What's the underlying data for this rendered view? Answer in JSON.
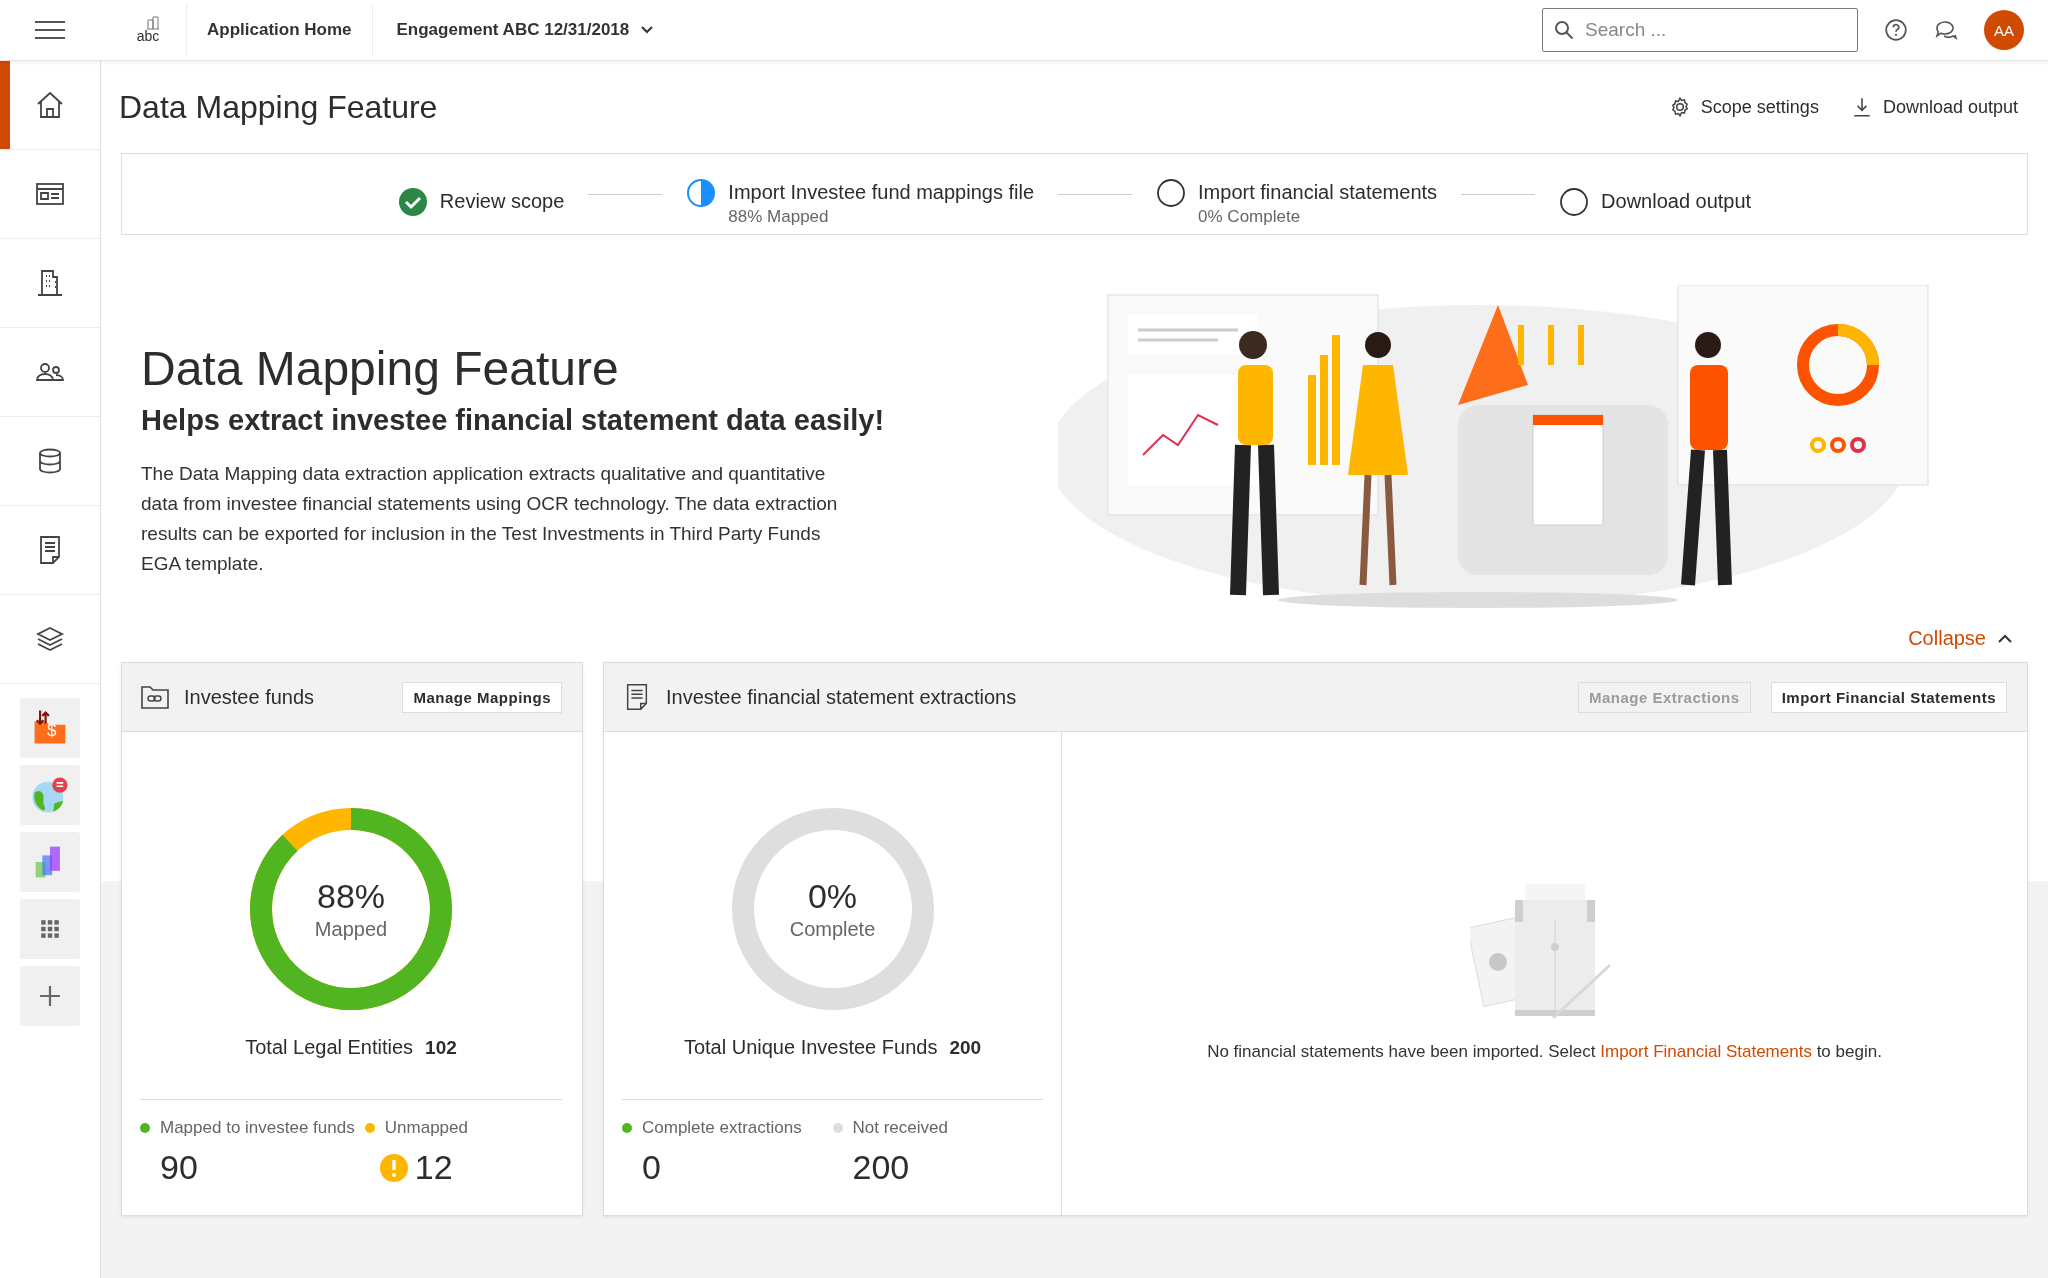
{
  "topbar": {
    "logo": "abc",
    "app_home": "Application Home",
    "engagement": "Engagement ABC 12/31/2018",
    "search": {
      "placeholder": "Search ..."
    },
    "avatar": "AA"
  },
  "sidebar": {
    "items": [
      {
        "kind": "home",
        "selected": true
      },
      {
        "kind": "browser",
        "selected": false
      },
      {
        "kind": "building",
        "selected": false
      },
      {
        "kind": "people",
        "selected": false
      },
      {
        "kind": "database",
        "selected": false
      },
      {
        "kind": "document",
        "selected": false
      },
      {
        "kind": "layers",
        "selected": false
      }
    ],
    "tiles": [
      {
        "kind": "folder-dollar",
        "glyph": "$"
      },
      {
        "kind": "globe"
      },
      {
        "kind": "bars"
      },
      {
        "kind": "grid"
      },
      {
        "kind": "plus"
      }
    ]
  },
  "page": {
    "title": "Data Mapping Feature",
    "actions": [
      {
        "kind": "settings",
        "label": "Scope settings"
      },
      {
        "kind": "download",
        "label": "Download output"
      }
    ]
  },
  "steps": [
    {
      "kind": "complete",
      "label": "Review scope"
    },
    {
      "kind": "partial",
      "label": "Import Investee fund mappings file",
      "detail": "88% Mapped"
    },
    {
      "kind": "pending",
      "label": "Import financial statements",
      "detail": "0% Complete"
    },
    {
      "kind": "pending",
      "label": "Download output"
    }
  ],
  "hero": {
    "title": "Data Mapping Feature",
    "subtitle": "Helps extract investee financial statement data easily!",
    "body": "The Data Mapping data extraction application extracts qualitative and quantitative data from investee financial statements using OCR technology. The data extraction results can be exported for inclusion in the Test Investments in Third Party Funds EGA template.",
    "collapse": "Collapse"
  },
  "panels": [
    {
      "kind": "funds",
      "title": "Investee funds",
      "buttons": [
        {
          "label": "Manage Mappings",
          "disabled": false
        }
      ],
      "donut": {
        "level": 0.88,
        "value": "88%",
        "caption": "Mapped"
      },
      "total_label": "Total Legal Entities",
      "total": "102",
      "legend": [
        {
          "label": "Mapped to investee funds",
          "color": "#50b520",
          "value": "90",
          "warning": false
        },
        {
          "label": "Unmapped",
          "color": "#ffb600",
          "value": "12",
          "warning": true
        }
      ]
    },
    {
      "kind": "extractions",
      "title": "Investee financial statement extractions",
      "buttons": [
        {
          "label": "Manage Extractions",
          "disabled": true
        },
        {
          "label": "Import Financial Statements",
          "disabled": false
        }
      ],
      "donut": {
        "level": 0,
        "value": "0%",
        "caption": "Complete"
      },
      "total_label": "Total Unique Investee Funds",
      "total": "200",
      "legend": [
        {
          "label": "Complete extractions",
          "color": "#50b520",
          "value": "0",
          "warning": false
        },
        {
          "label": "Not received",
          "color": "#dedede",
          "value": "200",
          "warning": false
        }
      ],
      "empty": {
        "before": "No financial statements have been imported. Select",
        "link": "Import Financial Statements",
        "after": "to begin."
      }
    }
  ]
}
